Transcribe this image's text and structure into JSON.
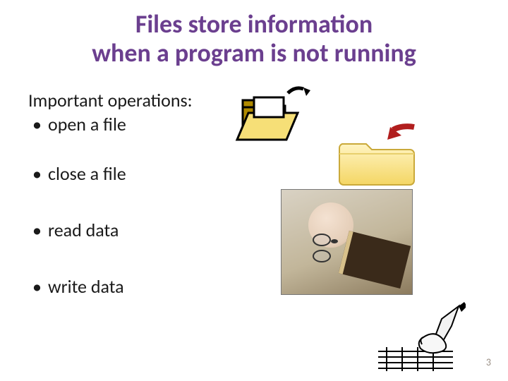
{
  "title_line1": "Files store information",
  "title_line2": "when a program is not running",
  "lead": "Important operations:",
  "bullets": {
    "b0": "open a file",
    "b1": "close a file",
    "b2": "read data",
    "b3": "write data"
  },
  "page_number": "3"
}
